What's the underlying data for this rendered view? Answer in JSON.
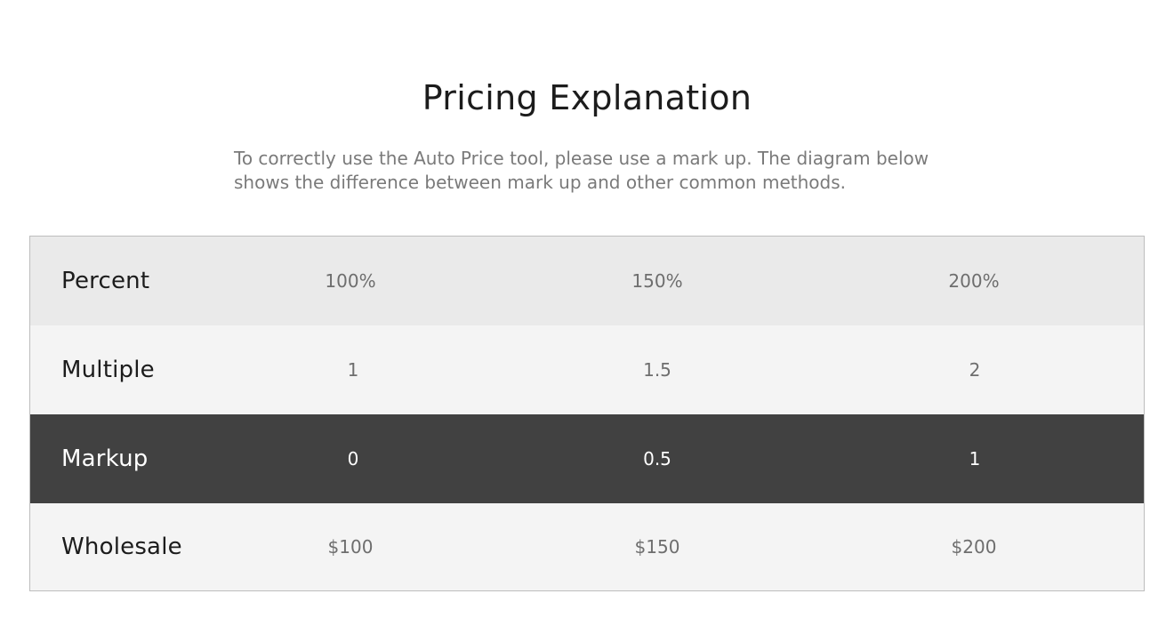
{
  "header": {
    "title": "Pricing Explanation",
    "description_line1": "To correctly use the Auto Price tool, please use a mark up. The diagram below",
    "description_line2": "shows the difference between mark up and other common methods."
  },
  "table": {
    "rows": [
      {
        "label": "Percent",
        "values": [
          "100%",
          "150%",
          "200%"
        ]
      },
      {
        "label": "Multiple",
        "values": [
          "1",
          "1.5",
          "2"
        ]
      },
      {
        "label": "Markup",
        "values": [
          "0",
          "0.5",
          "1"
        ]
      },
      {
        "label": "Wholesale",
        "values": [
          "$100",
          "$150",
          "$200"
        ]
      }
    ]
  },
  "colors": {
    "highlight_row_bg": "#414141",
    "header_row_bg": "#eaeaea",
    "row_bg": "#f4f4f4",
    "title_text": "#1c1c1c",
    "muted_text": "#7a7a7a"
  }
}
